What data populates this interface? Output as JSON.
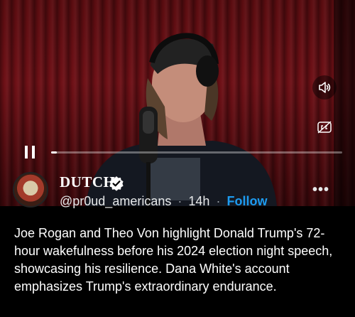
{
  "video": {
    "playback_state": "paused-icon-visible",
    "progress_fraction": 0.02
  },
  "post": {
    "display_name": "DUTCH",
    "handle": "@pr0ud_americans",
    "separator": "·",
    "time_ago": "14h",
    "follow_label": "Follow",
    "more_label": "•••",
    "text": "Joe Rogan and Theo Von highlight Donald Trump's 72-hour wakefulness before his 2024 election night speech, showcasing his resilience. Dana White's account emphasizes Trump's extraordinary endurance."
  },
  "colors": {
    "accent": "#1d9bf0",
    "background": "#000000",
    "verified_badge": "#ffffff"
  },
  "icons": [
    "pause-icon",
    "volume-icon",
    "captions-icon",
    "verified-badge-icon",
    "more-options-icon"
  ]
}
